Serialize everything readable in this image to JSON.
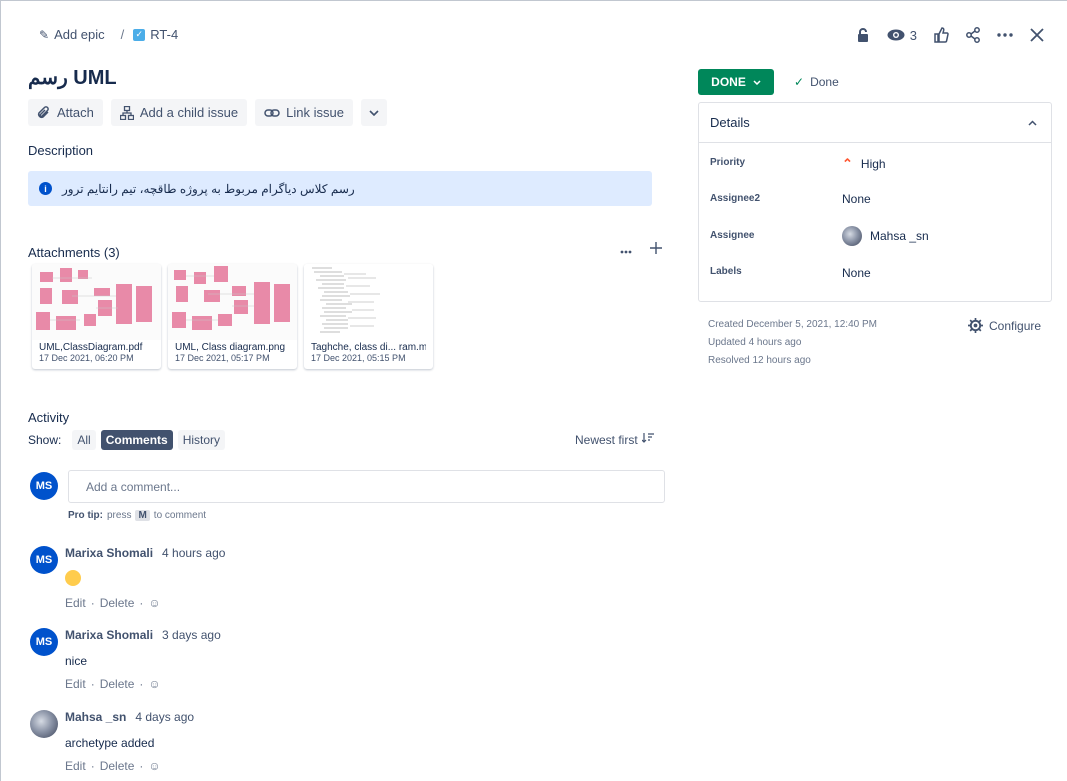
{
  "breadcrumb": {
    "epic_label": "Add epic",
    "issue_key": "RT-4"
  },
  "top_actions": {
    "watch_count": "3"
  },
  "issue": {
    "title": "رسم UML"
  },
  "toolbar": {
    "attach": "Attach",
    "add_child": "Add a child issue",
    "link_issue": "Link issue"
  },
  "description": {
    "label": "Description",
    "text": "رسم  کلاس دیاگرام مربوط به پروژه طاقچه، تیم رانتایم ترور"
  },
  "attachments": {
    "label": "Attachments (3)",
    "items": [
      {
        "name": "UML,ClassDiagram.pdf",
        "date": "17 Dec 2021, 06:20 PM"
      },
      {
        "name": "UML, Class diagram.png",
        "date": "17 Dec 2021, 05:17 PM"
      },
      {
        "name": "Taghche, class di... ram.mdl",
        "date": "17 Dec 2021, 05:15 PM"
      }
    ]
  },
  "activity": {
    "label": "Activity",
    "show_label": "Show:",
    "filters": [
      "All",
      "Comments",
      "History"
    ],
    "active_filter": "Comments",
    "sort_label": "Newest first",
    "comment_placeholder": "Add a comment...",
    "protip_prefix": "Pro tip:",
    "protip_press": "press",
    "protip_key": "M",
    "protip_suffix": "to comment",
    "current_user_initials": "MS"
  },
  "comments": [
    {
      "initials": "MS",
      "author": "Marixa Shomali",
      "time": "4 hours ago",
      "body": "",
      "emoji": "clapping-hands-emoji",
      "edit": "Edit",
      "delete": "Delete"
    },
    {
      "initials": "MS",
      "author": "Marixa Shomali",
      "time": "3 days ago",
      "body": "nice",
      "edit": "Edit",
      "delete": "Delete"
    },
    {
      "initials": "",
      "author": "Mahsa _sn",
      "time": "4 days ago",
      "body": "archetype added",
      "edit": "Edit",
      "delete": "Delete"
    }
  ],
  "status": {
    "button": "DONE",
    "resolution": "Done",
    "color": "#00875a"
  },
  "details": {
    "label": "Details",
    "priority_label": "Priority",
    "priority_value": "High",
    "assignee2_label": "Assignee2",
    "assignee2_value": "None",
    "assignee_label": "Assignee",
    "assignee_value": "Mahsa _sn",
    "labels_label": "Labels",
    "labels_value": "None"
  },
  "meta": {
    "created": "Created December 5, 2021, 12:40 PM",
    "updated": "Updated 4 hours ago",
    "resolved": "Resolved 12 hours ago",
    "configure": "Configure"
  }
}
